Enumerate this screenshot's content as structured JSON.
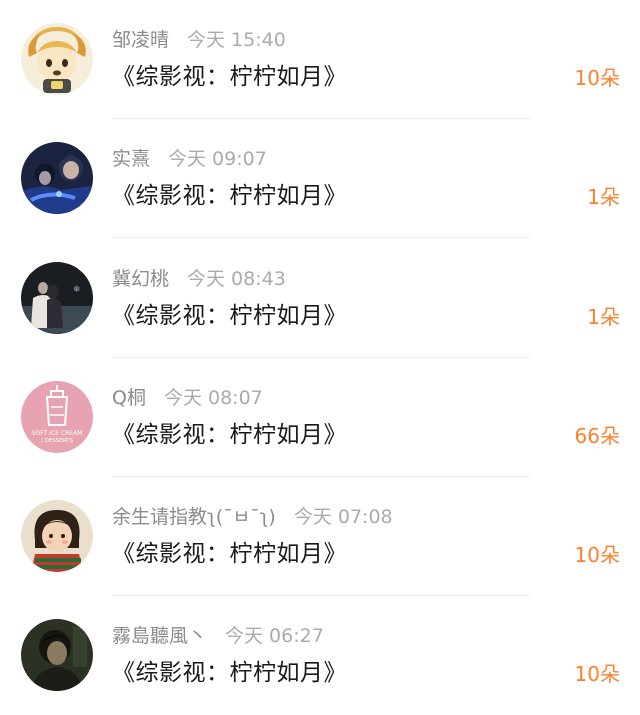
{
  "colors": {
    "accent": "#ff7f2a",
    "name_text": "#8c8c8c",
    "time_text": "#ababab",
    "title_text": "#1a1a1a",
    "divider": "#ededed"
  },
  "entries": [
    {
      "name": "邹凌晴",
      "time": "今天 15:40",
      "title": "《综影视：柠柠如月》",
      "amount": "10朵",
      "avatar_icon": "cartoon-lion-avatar"
    },
    {
      "name": "实熹",
      "time": "今天 09:07",
      "title": "《综影视：柠柠如月》",
      "amount": "1朵",
      "avatar_icon": "blue-couple-photo-avatar"
    },
    {
      "name": "冀幻桃",
      "time": "今天 08:43",
      "title": "《综影视：柠柠如月》",
      "amount": "1朵",
      "avatar_icon": "dark-couple-photo-avatar"
    },
    {
      "name": "Q桐",
      "time": "今天 08:07",
      "title": "《综影视：柠柠如月》",
      "amount": "66朵",
      "avatar_icon": "pink-ice-cream-avatar",
      "avatar_text": "SOFT ICE CREAM / DESSERTS"
    },
    {
      "name": "余生请指教ʅ(¯ㅂ¯ʅ)",
      "time": "今天 07:08",
      "title": "《综影视：柠柠如月》",
      "amount": "10朵",
      "avatar_icon": "cartoon-girl-avatar"
    },
    {
      "name": "霧島聽風丶",
      "time": "今天 06:27",
      "title": "《综影视：柠柠如月》",
      "amount": "10朵",
      "avatar_icon": "dark-portrait-avatar"
    }
  ]
}
